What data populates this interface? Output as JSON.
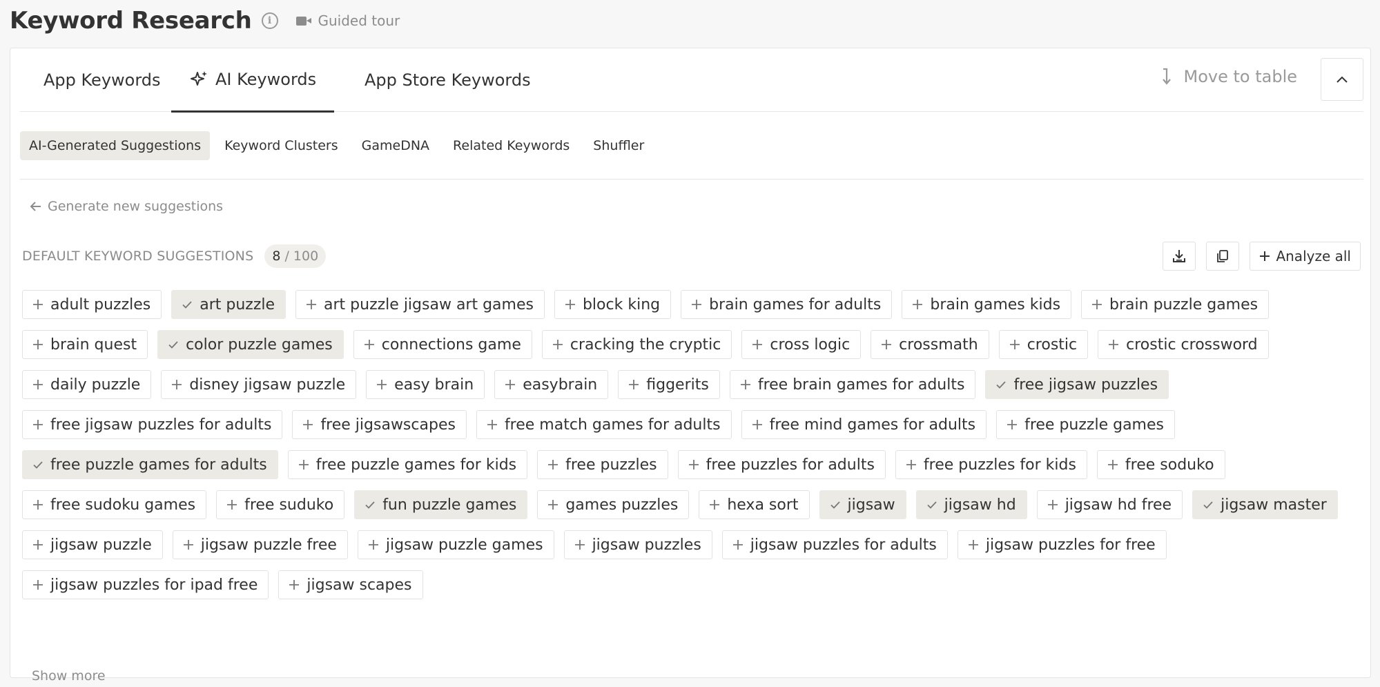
{
  "header": {
    "title": "Keyword Research",
    "guided_tour": "Guided tour"
  },
  "tabs": [
    {
      "label": "App Keywords",
      "active": false
    },
    {
      "label": "AI Keywords",
      "active": true
    },
    {
      "label": "App Store Keywords",
      "active": false
    }
  ],
  "toolbar": {
    "move_to_table": "Move to table"
  },
  "subtabs": [
    {
      "label": "AI-Generated Suggestions",
      "active": true
    },
    {
      "label": "Keyword Clusters",
      "active": false
    },
    {
      "label": "GameDNA",
      "active": false
    },
    {
      "label": "Related Keywords",
      "active": false
    },
    {
      "label": "Shuffler",
      "active": false
    }
  ],
  "generate_new": "Generate new suggestions",
  "section": {
    "title": "DEFAULT KEYWORD SUGGESTIONS",
    "selected": "8",
    "total": "/ 100",
    "analyze_all": "Analyze all"
  },
  "keywords": [
    {
      "label": "adult puzzles",
      "selected": false
    },
    {
      "label": "art puzzle",
      "selected": true
    },
    {
      "label": "art puzzle jigsaw art games",
      "selected": false
    },
    {
      "label": "block king",
      "selected": false
    },
    {
      "label": "brain games for adults",
      "selected": false
    },
    {
      "label": "brain games kids",
      "selected": false
    },
    {
      "label": "brain puzzle games",
      "selected": false
    },
    {
      "label": "brain quest",
      "selected": false
    },
    {
      "label": "color puzzle games",
      "selected": true
    },
    {
      "label": "connections game",
      "selected": false
    },
    {
      "label": "cracking the cryptic",
      "selected": false
    },
    {
      "label": "cross logic",
      "selected": false
    },
    {
      "label": "crossmath",
      "selected": false
    },
    {
      "label": "crostic",
      "selected": false
    },
    {
      "label": "crostic crossword",
      "selected": false
    },
    {
      "label": "daily puzzle",
      "selected": false
    },
    {
      "label": "disney jigsaw puzzle",
      "selected": false
    },
    {
      "label": "easy brain",
      "selected": false
    },
    {
      "label": "easybrain",
      "selected": false
    },
    {
      "label": "figgerits",
      "selected": false
    },
    {
      "label": "free brain games for adults",
      "selected": false
    },
    {
      "label": "free jigsaw puzzles",
      "selected": true
    },
    {
      "label": "free jigsaw puzzles for adults",
      "selected": false
    },
    {
      "label": "free jigsawscapes",
      "selected": false
    },
    {
      "label": "free match games for adults",
      "selected": false
    },
    {
      "label": "free mind games for adults",
      "selected": false
    },
    {
      "label": "free puzzle games",
      "selected": false
    },
    {
      "label": "free puzzle games for adults",
      "selected": true
    },
    {
      "label": "free puzzle games for kids",
      "selected": false
    },
    {
      "label": "free puzzles",
      "selected": false
    },
    {
      "label": "free puzzles for adults",
      "selected": false
    },
    {
      "label": "free puzzles for kids",
      "selected": false
    },
    {
      "label": "free soduko",
      "selected": false
    },
    {
      "label": "free sudoku games",
      "selected": false
    },
    {
      "label": "free suduko",
      "selected": false
    },
    {
      "label": "fun puzzle games",
      "selected": true
    },
    {
      "label": "games puzzles",
      "selected": false
    },
    {
      "label": "hexa sort",
      "selected": false
    },
    {
      "label": "jigsaw",
      "selected": true
    },
    {
      "label": "jigsaw hd",
      "selected": true
    },
    {
      "label": "jigsaw hd free",
      "selected": false
    },
    {
      "label": "jigsaw master",
      "selected": true
    },
    {
      "label": "jigsaw puzzle",
      "selected": false
    },
    {
      "label": "jigsaw puzzle free",
      "selected": false
    },
    {
      "label": "jigsaw puzzle games",
      "selected": false
    },
    {
      "label": "jigsaw puzzles",
      "selected": false
    },
    {
      "label": "jigsaw puzzles for adults",
      "selected": false
    },
    {
      "label": "jigsaw puzzles for free",
      "selected": false
    },
    {
      "label": "jigsaw puzzles for ipad free",
      "selected": false
    },
    {
      "label": "jigsaw scapes",
      "selected": false
    }
  ],
  "show_more": "Show more",
  "icons": {
    "info": "info-icon",
    "tour": "video-camera-icon",
    "ai": "sparkle-icon",
    "move": "arrow-down-right-icon",
    "collapse": "chevron-up-icon",
    "back": "arrow-left-icon",
    "download": "download-icon",
    "copy": "copy-icon",
    "add": "plus-icon",
    "check": "check-icon"
  },
  "colors": {
    "selected_chip_bg": "#eceae5",
    "text": "#333333",
    "muted": "#8c8c8c"
  }
}
